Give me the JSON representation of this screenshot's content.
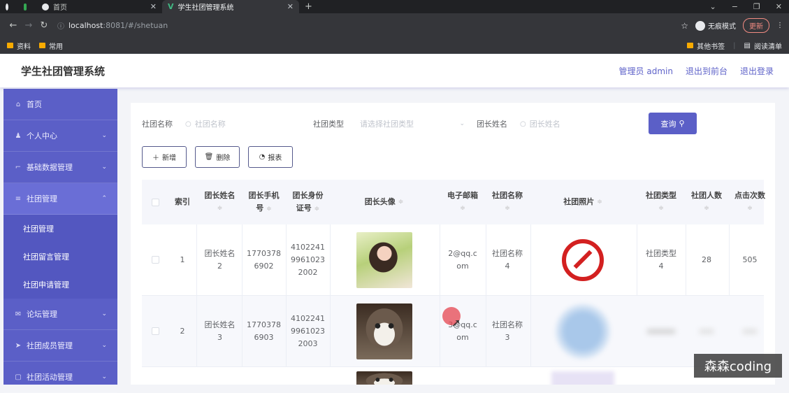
{
  "browser": {
    "tabs": [
      {
        "label": "",
        "icon": "github-icon"
      },
      {
        "label": "",
        "icon": "sheet-icon"
      },
      {
        "label": "首页",
        "icon": "globe-icon"
      },
      {
        "label": "学生社团管理系统",
        "icon": "vue-icon"
      }
    ],
    "new_tab": "+",
    "url_host": "localhost",
    "url_path": ":8081/#/shetuan",
    "incognito_label": "无痕模式",
    "update_label": "更新",
    "bookmarks": [
      "资料",
      "常用"
    ],
    "bookmarks_right": [
      "其他书签",
      "阅读清单"
    ]
  },
  "header": {
    "title": "学生社团管理系统",
    "admin": "管理员 admin",
    "to_front": "退出到前台",
    "logout": "退出登录"
  },
  "sidebar": {
    "items": [
      {
        "label": "首页",
        "icon": "home-icon",
        "chev": ""
      },
      {
        "label": "个人中心",
        "icon": "user-icon",
        "chev": "⌄"
      },
      {
        "label": "基础数据管理",
        "icon": "data-icon",
        "chev": "⌄"
      },
      {
        "label": "社团管理",
        "icon": "list-icon",
        "chev": "⌃"
      }
    ],
    "sub_items": [
      "社团管理",
      "社团留言管理",
      "社团申请管理"
    ],
    "items_after": [
      {
        "label": "论坛管理",
        "icon": "mail-icon",
        "chev": "⌄"
      },
      {
        "label": "社团成员管理",
        "icon": "send-icon",
        "chev": "⌄"
      },
      {
        "label": "社团活动管理",
        "icon": "calendar-icon",
        "chev": "⌄"
      }
    ]
  },
  "search": {
    "name_label": "社团名称",
    "name_placeholder": "社团名称",
    "type_label": "社团类型",
    "type_placeholder": "请选择社团类型",
    "leader_label": "团长姓名",
    "leader_placeholder": "团长姓名",
    "query_button": "查询"
  },
  "actions": {
    "add": "新增",
    "delete": "删除",
    "report": "报表"
  },
  "table": {
    "headers": {
      "index": "索引",
      "leader_name": [
        "团长姓名",
        ""
      ],
      "leader_phone": [
        "团长手机",
        "号"
      ],
      "leader_id": [
        "团长身份",
        "证号"
      ],
      "leader_avatar": "团长头像",
      "email": [
        "电子邮箱",
        ""
      ],
      "club_name": [
        "社团名称",
        ""
      ],
      "club_photo": "社团照片",
      "club_type": [
        "社团类型",
        ""
      ],
      "club_count": [
        "社团人数",
        ""
      ],
      "clicks": [
        "点击次数",
        ""
      ]
    },
    "rows": [
      {
        "index": "1",
        "leader_name": [
          "团长姓名",
          "2"
        ],
        "leader_phone": [
          "1770378",
          "6902"
        ],
        "leader_id": [
          "4102241",
          "9961023",
          "2002"
        ],
        "email": [
          "2@qq.c",
          "om"
        ],
        "club_name": [
          "社团名称",
          "4"
        ],
        "club_type": [
          "社团类型",
          "4"
        ],
        "club_count": "28",
        "clicks": "505"
      },
      {
        "index": "2",
        "leader_name": [
          "团长姓名",
          "3"
        ],
        "leader_phone": [
          "1770378",
          "6903"
        ],
        "leader_id": [
          "4102241",
          "9961023",
          "2003"
        ],
        "email": [
          "3@qq.c",
          "om"
        ],
        "club_name": [
          "社团名称",
          "3"
        ],
        "club_type": [
          "",
          ""
        ],
        "club_count": "",
        "clicks": ""
      }
    ]
  },
  "watermark": "森森coding"
}
